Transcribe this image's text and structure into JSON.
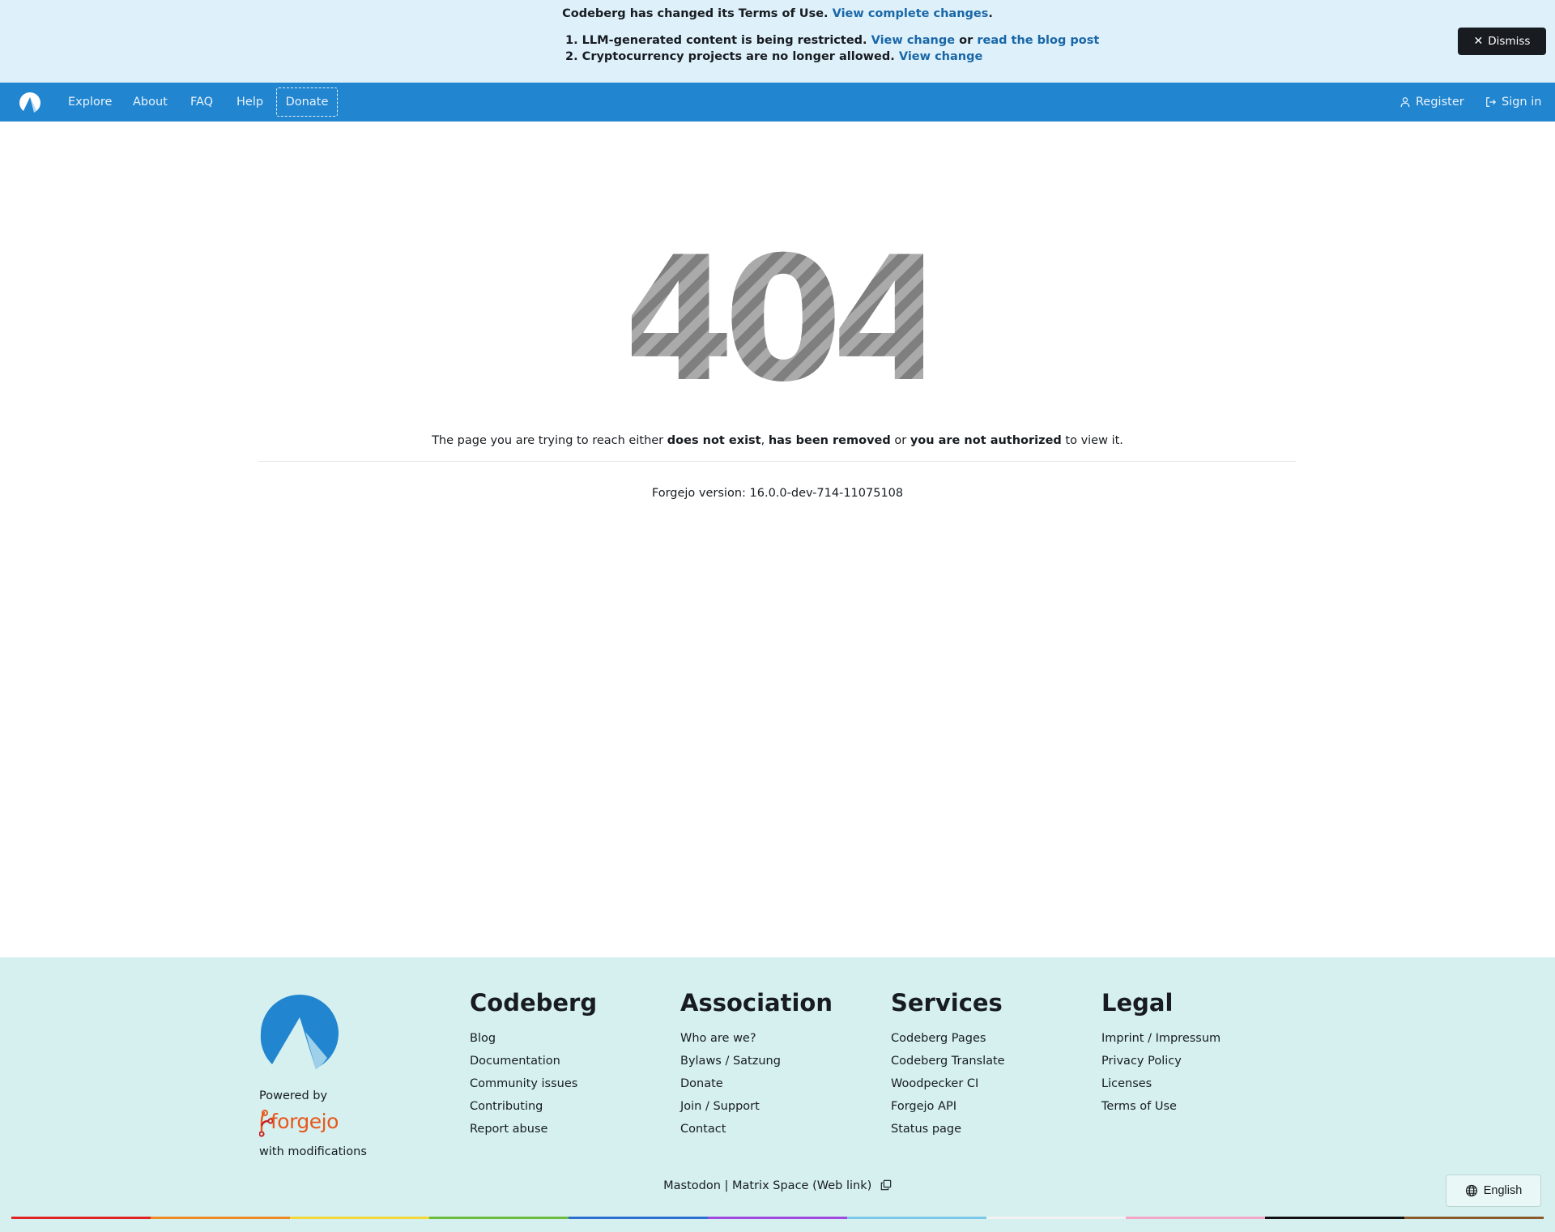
{
  "banner": {
    "intro": "Codeberg has changed its Terms of Use.",
    "intro_link": "View complete changes",
    "intro_end": ".",
    "item1_num": "1.",
    "item1_text": "LLM-generated content is being restricted.",
    "item1_link1": "View change",
    "item1_or": "or",
    "item1_link2": "read the blog post",
    "item2_num": "2.",
    "item2_text": "Cryptocurrency projects are no longer allowed.",
    "item2_link": "View change",
    "dismiss_label": "Dismiss"
  },
  "nav": {
    "items": [
      "Explore",
      "About",
      "FAQ",
      "Help"
    ],
    "donate": "Donate",
    "register": "Register",
    "sign_in": "Sign in"
  },
  "main": {
    "code": "404",
    "msg_start": "The page you are trying to reach either",
    "msg_b1": "does not exist",
    "msg_comma": ",",
    "msg_b2": "has been removed",
    "msg_or": "or",
    "msg_b3": "you are not authorized",
    "msg_end": "to view it.",
    "version": "Forgejo version: 16.0.0-dev-714-11075108"
  },
  "footer": {
    "powered_by": "Powered by",
    "forgejo": "forgejo",
    "with_modifications": "with modifications",
    "columns": [
      {
        "title": "Codeberg",
        "links": [
          "Blog",
          "Documentation",
          "Community issues",
          "Contributing",
          "Report abuse"
        ]
      },
      {
        "title": "Association",
        "links": [
          "Who are we?",
          "Bylaws / Satzung",
          "Donate",
          "Join / Support",
          "Contact"
        ]
      },
      {
        "title": "Services",
        "links": [
          "Codeberg Pages",
          "Codeberg Translate",
          "Woodpecker CI",
          "Forgejo API",
          "Status page"
        ]
      },
      {
        "title": "Legal",
        "links": [
          "Imprint / Impressum",
          "Privacy Policy",
          "Licenses",
          "Terms of Use"
        ]
      }
    ],
    "mastodon": "Mastodon",
    "separator": "|",
    "matrix": "Matrix Space (Web link)",
    "language": "English"
  },
  "colors": {
    "banner_bg": "#def1fa",
    "navbar_bg": "#2185d0",
    "footer_bg": "#d5f0ef",
    "link": "#1a67a8",
    "rainbow": [
      "#e02424",
      "#f08a24",
      "#f3d63a",
      "#6dbb3f",
      "#2b6fd1",
      "#a24ae0",
      "#7dc8e8",
      "#f2f2f2",
      "#f4a6c6",
      "#111111",
      "#8a5a2b"
    ]
  }
}
